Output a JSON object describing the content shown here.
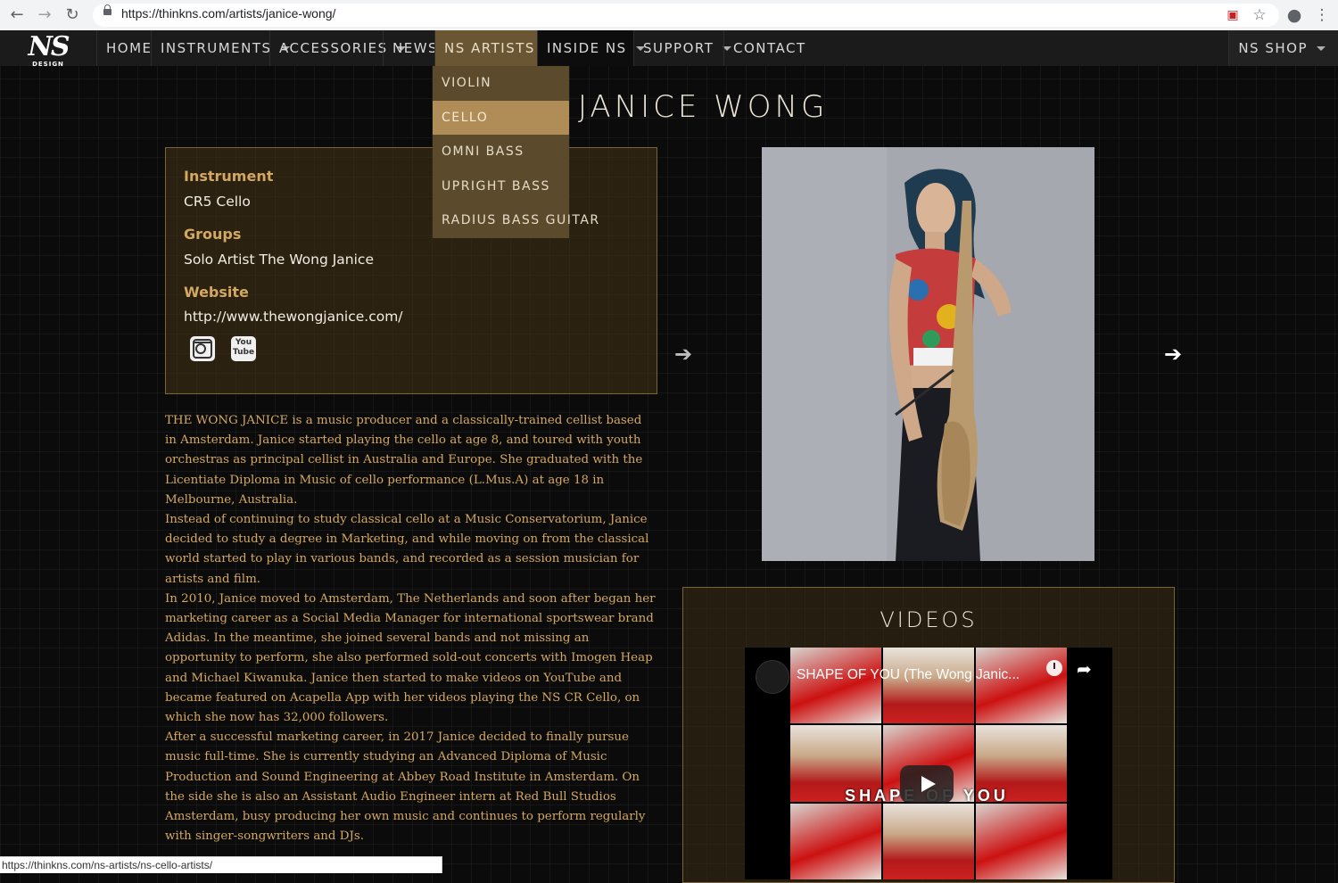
{
  "browser": {
    "url": "https://thinkns.com/artists/janice-wong/",
    "status_url": "https://thinkns.com/ns-artists/ns-cello-artists/"
  },
  "logo": {
    "main": "NS",
    "sub": "DESIGN"
  },
  "nav": {
    "items": [
      {
        "label": "HOME",
        "dropdown": false
      },
      {
        "label": "INSTRUMENTS",
        "dropdown": true
      },
      {
        "label": "ACCESSORIES",
        "dropdown": true
      },
      {
        "label": "NEWS",
        "dropdown": false
      },
      {
        "label": "NS ARTISTS",
        "dropdown": true,
        "active": true
      },
      {
        "label": "INSIDE NS",
        "dropdown": true
      },
      {
        "label": "SUPPORT",
        "dropdown": true
      },
      {
        "label": "CONTACT",
        "dropdown": false
      }
    ],
    "shop": "NS SHOP"
  },
  "dropdown": {
    "items": [
      "VIOLIN",
      "CELLO",
      "OMNI BASS",
      "UPRIGHT BASS",
      "RADIUS BASS GUITAR"
    ],
    "hovered": "CELLO"
  },
  "page": {
    "title": "JANICE WONG"
  },
  "info": {
    "instrument_label": "Instrument",
    "instrument_value": "CR5 Cello",
    "groups_label": "Groups",
    "groups_value": "Solo Artist The Wong Janice",
    "website_label": "Website",
    "website_value": "http://www.thewongjanice.com/",
    "youtube_icon_text": "You Tube"
  },
  "bio": [
    "THE WONG JANICE is a music producer and a classically-trained cellist based in Amsterdam. Janice started playing the cello at age 8, and toured with youth orchestras as principal cellist in Australia and Europe. She graduated with the Licentiate Diploma in Music of cello performance (L.Mus.A) at age 18 in Melbourne, Australia.",
    "Instead of continuing to study classical cello at a Music Conservatorium, Janice decided to study a degree in Marketing, and while moving on from the classical world started to play in various bands, and recorded as a session musician for artists and film.",
    "In 2010, Janice moved to Amsterdam, The Netherlands and soon after began her marketing career as a Social Media Manager for international sportswear brand Adidas. In the meantime, she joined several bands and not missing an opportunity to perform, she also performed sold-out concerts with Imogen Heap and Michael Kiwanuka. Janice then started to make videos on YouTube and became featured on Acapella App with her videos playing the NS CR Cello, on which she now has 32,000 followers.",
    "After a successful marketing career, in 2017 Janice decided to finally pursue music full-time. She is currently studying an Advanced Diploma of Music Production and Sound Engineering at Abbey Road Institute in Amsterdam. On the side she is also an Assistant Audio Engineer intern at Red Bull Studios Amsterdam, busy producing her own music and continues to perform regularly with singer-songwriters and DJs."
  ],
  "videos": {
    "title": "VIDEOS",
    "video_title": "SHAPE OF YOU (The Wong Janic...",
    "overlay": "SHAPE OF YOU"
  },
  "colors": {
    "accent_gold": "#d4a860",
    "active_nav": "#6b5633",
    "dropdown_bg": "#5c4a2c",
    "dropdown_hover": "#b08c57"
  }
}
